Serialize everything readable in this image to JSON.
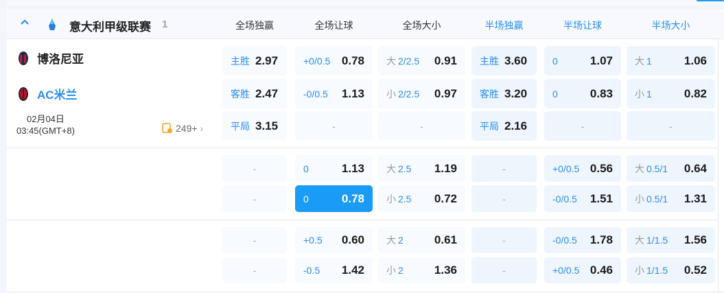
{
  "league": {
    "name": "意大利甲级联赛",
    "count": "1"
  },
  "columns": [
    {
      "label": "全场独赢",
      "half": false
    },
    {
      "label": "全场让球",
      "half": false
    },
    {
      "label": "全场大小",
      "half": false
    },
    {
      "label": "半场独赢",
      "half": true
    },
    {
      "label": "半场让球",
      "half": true
    },
    {
      "label": "半场大小",
      "half": true
    }
  ],
  "match": {
    "home": "博洛尼亚",
    "away": "AC米兰",
    "date": "02月04日",
    "time": "03:45(GMT+8)",
    "more_count": "249+"
  },
  "colors": {
    "accent": "#1a9bf5",
    "away_team": "#2a8df0"
  },
  "groups": [
    [
      [
        {
          "pre": "主胜",
          "odds": "2.97"
        },
        {
          "line": "+0/0.5",
          "odds": "0.78"
        },
        {
          "pre": "大",
          "line": "2/2.5",
          "odds": "0.91"
        },
        {
          "pre": "主胜",
          "odds": "3.60"
        },
        {
          "line": "0",
          "odds": "1.07"
        },
        {
          "pre": "大",
          "line": "1",
          "odds": "1.06"
        }
      ],
      [
        {
          "pre": "客胜",
          "odds": "2.47"
        },
        {
          "line": "-0/0.5",
          "odds": "1.13"
        },
        {
          "pre": "小",
          "line": "2/2.5",
          "odds": "0.97"
        },
        {
          "pre": "客胜",
          "odds": "3.20"
        },
        {
          "line": "0",
          "odds": "0.83"
        },
        {
          "pre": "小",
          "line": "1",
          "odds": "0.82"
        }
      ],
      [
        {
          "pre": "平局",
          "odds": "3.15"
        },
        null,
        null,
        {
          "pre": "平局",
          "odds": "2.16"
        },
        null,
        null
      ]
    ],
    [
      [
        null,
        {
          "line": "0",
          "odds": "1.13"
        },
        {
          "pre": "大",
          "line": "2.5",
          "odds": "1.19"
        },
        null,
        {
          "line": "+0/0.5",
          "odds": "0.56"
        },
        {
          "pre": "大",
          "line": "0.5/1",
          "odds": "0.64"
        }
      ],
      [
        null,
        {
          "line": "0",
          "odds": "0.78",
          "selected": true
        },
        {
          "pre": "小",
          "line": "2.5",
          "odds": "0.72"
        },
        null,
        {
          "line": "-0/0.5",
          "odds": "1.51"
        },
        {
          "pre": "小",
          "line": "0.5/1",
          "odds": "1.31"
        }
      ]
    ],
    [
      [
        null,
        {
          "line": "+0.5",
          "odds": "0.60"
        },
        {
          "pre": "大",
          "line": "2",
          "odds": "0.61"
        },
        null,
        {
          "line": "-0/0.5",
          "odds": "1.78"
        },
        {
          "pre": "大",
          "line": "1/1.5",
          "odds": "1.56"
        }
      ],
      [
        null,
        {
          "line": "-0.5",
          "odds": "1.42"
        },
        {
          "pre": "小",
          "line": "2",
          "odds": "1.36"
        },
        null,
        {
          "line": "+0/0.5",
          "odds": "0.46"
        },
        {
          "pre": "小",
          "line": "1/1.5",
          "odds": "0.52"
        }
      ]
    ]
  ]
}
